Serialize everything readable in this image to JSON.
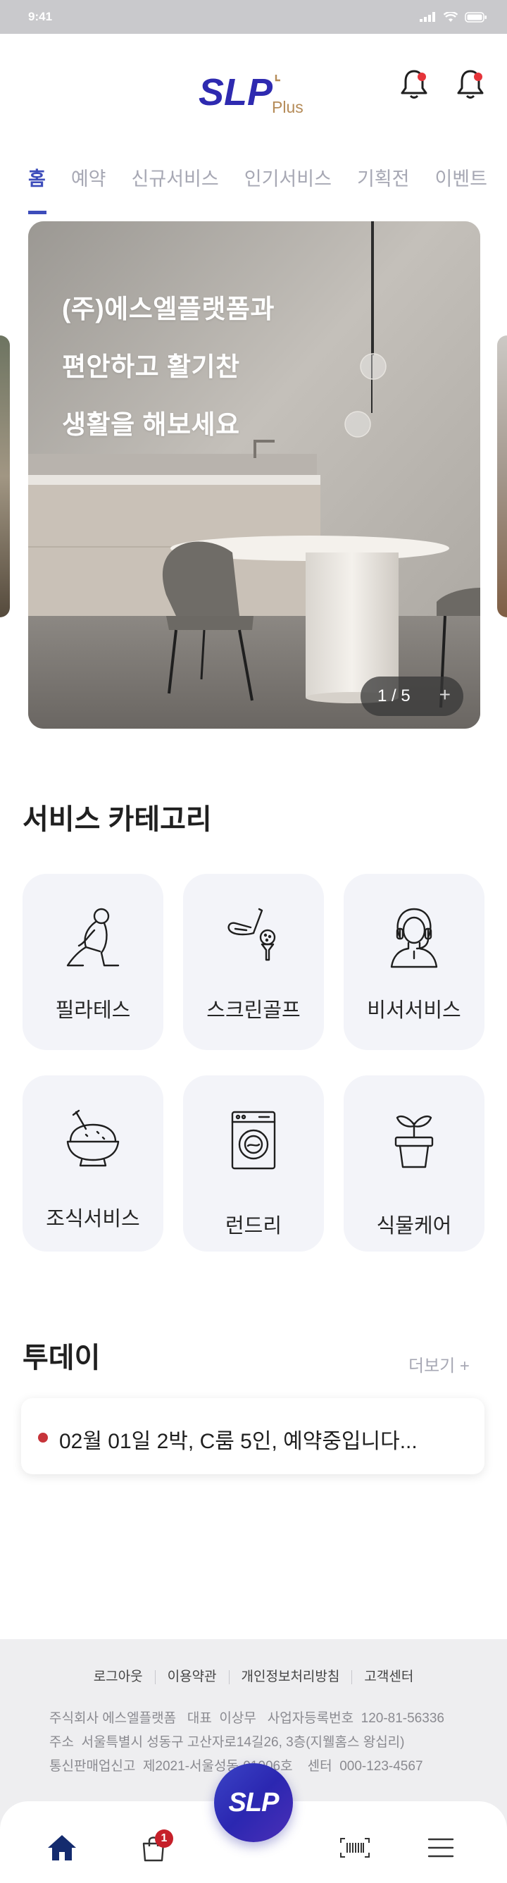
{
  "status_bar": {
    "time": "9:41"
  },
  "header": {
    "logo_text": "SLP",
    "logo_suffix": "Plus"
  },
  "tabs": [
    {
      "label": "홈",
      "active": true
    },
    {
      "label": "예약",
      "active": false
    },
    {
      "label": "신규서비스",
      "active": false
    },
    {
      "label": "인기서비스",
      "active": false
    },
    {
      "label": "기획전",
      "active": false
    },
    {
      "label": "이벤트",
      "active": false
    }
  ],
  "banner": {
    "lines": [
      "(주)에스엘플랫폼과",
      "편안하고 활기찬",
      "생활을 해보세요"
    ],
    "pager": "1 / 5",
    "pager_more": "+"
  },
  "categories": {
    "title": "서비스 카테고리",
    "items": [
      {
        "label": "필라테스",
        "icon": "pilates-icon"
      },
      {
        "label": "스크린골프",
        "icon": "golf-icon"
      },
      {
        "label": "비서서비스",
        "icon": "secretary-icon"
      },
      {
        "label": "조식서비스",
        "icon": "breakfast-icon"
      },
      {
        "label": "런드리",
        "icon": "laundry-icon"
      },
      {
        "label": "식물케어",
        "icon": "plant-icon"
      }
    ]
  },
  "today": {
    "title": "투데이",
    "more": "더보기 +",
    "item": "02월 01일 2박, C룸 5인, 예약중입니다..."
  },
  "footer": {
    "links": [
      "로그아웃",
      "이용약관",
      "개인정보처리방침",
      "고객센터"
    ],
    "info": [
      "주식회사 에스엘플랫폼   대표  이상무   사업자등록번호  120-81-56336",
      "주소  서울특별시 성동구 고산자로14길26, 3층(지웰홈스 왕십리)",
      "통신판매업신고  제2021-서울성동-01006호    센터  000-123-4567"
    ]
  },
  "bottom_nav": {
    "fab_label": "SLP",
    "cart_badge": "1",
    "items": [
      "home-icon",
      "cart-icon",
      "barcode-icon",
      "menu-icon"
    ]
  },
  "colors": {
    "brand": "#3d4dbb",
    "logo_plus": "#b58b58",
    "alert_dot": "#e5343a",
    "card_bg": "#f3f4f9"
  }
}
